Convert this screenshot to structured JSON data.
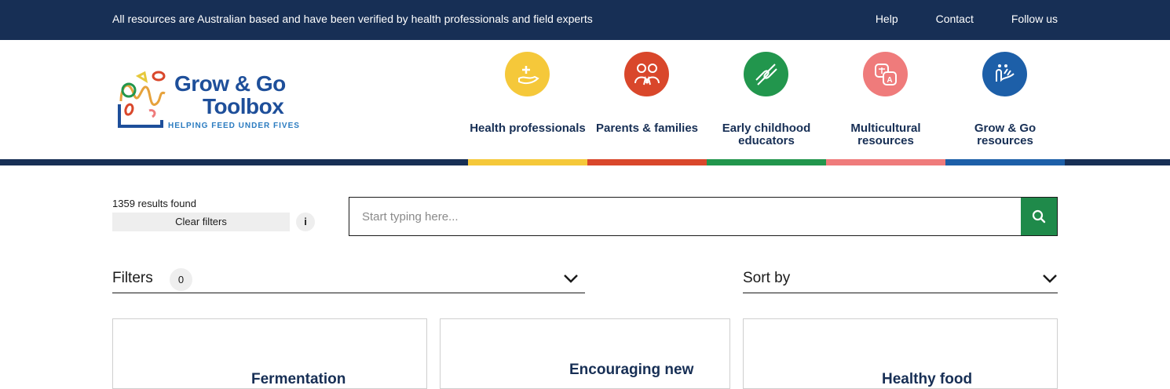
{
  "topbar": {
    "message": "All resources are Australian based and have been verified by health professionals and field experts",
    "links": [
      "Help",
      "Contact",
      "Follow us"
    ]
  },
  "logo": {
    "line1": "Grow & Go",
    "line2": "Toolbox",
    "tagline": "HELPING FEED UNDER FIVES"
  },
  "nav": {
    "items": [
      {
        "label": "Health professionals",
        "icon": "hand-plus-icon",
        "color": "#f5c83a"
      },
      {
        "label": "Parents & families",
        "icon": "family-icon",
        "color": "#d9472b"
      },
      {
        "label": "Early childhood educators",
        "icon": "handshake-icon",
        "color": "#22964d"
      },
      {
        "label": "Multicultural resources",
        "icon": "translate-icon",
        "color": "#ef7b7b"
      },
      {
        "label": "Grow & Go resources",
        "icon": "sprout-hand-icon",
        "color": "#1d5fa8"
      }
    ]
  },
  "search_panel": {
    "results": "1359 results found",
    "clear_filters": "Clear filters",
    "info": "i",
    "placeholder": "Start typing here..."
  },
  "filters": {
    "label": "Filters",
    "count": "0"
  },
  "sort": {
    "label": "Sort by"
  },
  "cards": [
    {
      "title": "Fermentation"
    },
    {
      "title": "Encouraging new"
    },
    {
      "title": "Healthy food"
    }
  ],
  "colors": {
    "navy": "#172f55",
    "green": "#1f8a4a"
  }
}
